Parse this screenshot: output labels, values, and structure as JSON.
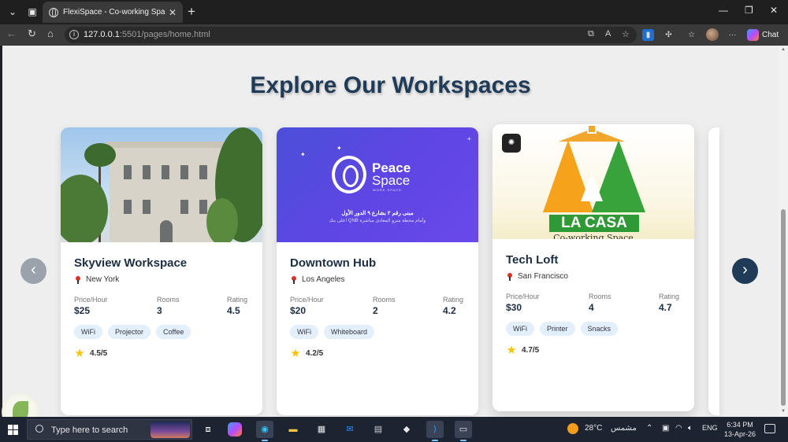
{
  "browser": {
    "tab_title": "FlexiSpace - Co-working Spaces",
    "url_host": "127.0.0.1",
    "url_path": ":5501/pages/home.html",
    "chat_label": "Chat"
  },
  "page": {
    "heading": "Explore Our Workspaces",
    "accent_color": "#1f3b57",
    "prev_label": "‹",
    "next_label": "›"
  },
  "cards": [
    {
      "name": "Skyview Workspace",
      "location": "New York",
      "price_label": "Price/Hour",
      "price": "$25",
      "rooms_label": "Rooms",
      "rooms": "3",
      "rating_label": "Rating",
      "rating": "4.5",
      "tags": [
        "WiFi",
        "Projector",
        "Coffee"
      ],
      "rating_text": "4.5/5"
    },
    {
      "name": "Downtown Hub",
      "location": "Los Angeles",
      "price_label": "Price/Hour",
      "price": "$20",
      "rooms_label": "Rooms",
      "rooms": "2",
      "rating_label": "Rating",
      "rating": "4.2",
      "tags": [
        "WiFi",
        "Whiteboard"
      ],
      "rating_text": "4.2/5",
      "image": {
        "brand_top": "Peace",
        "brand_bottom": "Space",
        "brand_tag": "WORK SPACE",
        "line1": "مبنى رقم ٢ بشارع ٩ الدور الأول",
        "line2": "اعلى بنك QNB وأمام محطة مترو المعادى مباشرة"
      }
    },
    {
      "name": "Tech Loft",
      "location": "San Francisco",
      "price_label": "Price/Hour",
      "price": "$30",
      "rooms_label": "Rooms",
      "rooms": "4",
      "rating_label": "Rating",
      "rating": "4.7",
      "tags": [
        "WiFi",
        "Printer",
        "Snacks"
      ],
      "rating_text": "4.7/5",
      "image": {
        "brand": "LA CASA",
        "sub": "Co-working Space"
      }
    }
  ],
  "taskbar": {
    "search_placeholder": "Type here to search",
    "weather_temp": "28°C",
    "weather_desc": "مشمس",
    "language": "ENG",
    "time": "6:34 PM",
    "date": "13-Apr-26"
  }
}
